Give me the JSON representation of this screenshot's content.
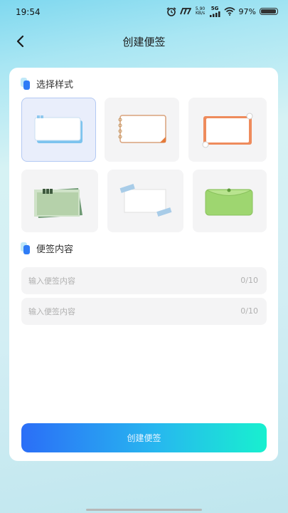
{
  "status_bar": {
    "time": "19:54",
    "net_speed_value": "5.90",
    "net_speed_unit": "KB/s",
    "network_type": "5G",
    "battery_percent": "97%",
    "battery_level": 0.97
  },
  "header": {
    "title": "创建便签"
  },
  "style_section": {
    "title": "选择样式",
    "selected_index": 0
  },
  "content_section": {
    "title": "便签内容",
    "inputs": [
      {
        "value": "",
        "placeholder": "输入便签内容",
        "counter": "0/10"
      },
      {
        "value": "",
        "placeholder": "输入便签内容",
        "counter": "0/10"
      }
    ]
  },
  "submit_label": "创建便签",
  "colors": {
    "accent_blue": "#2b6ef7",
    "accent_teal": "#18f0cf",
    "selected_tile_bg": "#e9eefb"
  }
}
